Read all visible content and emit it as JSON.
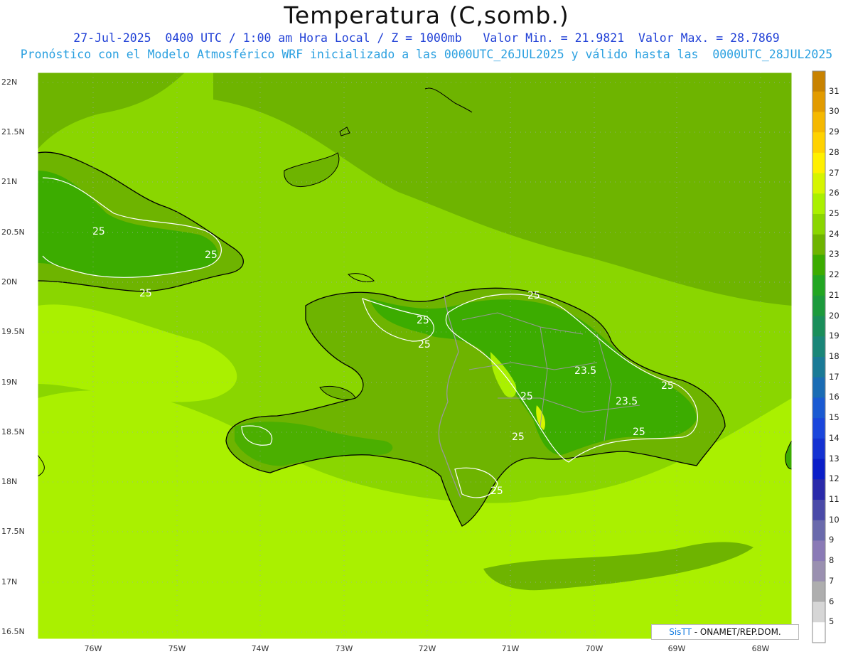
{
  "title": "Temperatura (C,somb.)",
  "subtitle_line1": "27-Jul-2025  0400 UTC / 1:00 am Hora Local / Z = 1000mb   Valor Min. = 21.9821  Valor Max. = 28.7869",
  "subtitle_line2": "Pronóstico con el Modelo Atmosférico WRF inicializado a las 0000UTC_26JUL2025 y válido hasta las  0000UTC_28JUL2025",
  "lat_labels": [
    "22N",
    "21.5N",
    "21N",
    "20.5N",
    "20N",
    "19.5N",
    "19N",
    "18.5N",
    "18N",
    "17.5N",
    "17N",
    "16.5N"
  ],
  "lon_labels": [
    "76W",
    "75W",
    "74W",
    "73W",
    "72W",
    "71W",
    "70W",
    "69W",
    "68W"
  ],
  "contour_labels": [
    "25",
    "25",
    "25",
    "25",
    "25",
    "25",
    "23.5",
    "23.5",
    "25",
    "25",
    "25",
    "25",
    "25"
  ],
  "colorbar": {
    "labels": [
      "31",
      "30",
      "29",
      "28",
      "27",
      "26",
      "25",
      "24",
      "23",
      "22",
      "21",
      "20",
      "19",
      "18",
      "17",
      "16",
      "15",
      "14",
      "13",
      "12",
      "11",
      "10",
      "9",
      "8",
      "7",
      "6",
      "5"
    ],
    "colors": [
      "#c88200",
      "#e29b00",
      "#f5b800",
      "#ffd200",
      "#fff000",
      "#d6f500",
      "#aaf000",
      "#8ad600",
      "#6eb400",
      "#3cac00",
      "#22a622",
      "#1c9a3c",
      "#1a8e5a",
      "#1a8678",
      "#1a7a96",
      "#1a6cb4",
      "#1a5ad2",
      "#1a46dc",
      "#1432d2",
      "#0a1ec8",
      "#2a2aaa",
      "#4a4aa8",
      "#6a6aac",
      "#8a7ab6",
      "#9a90b0",
      "#aeaeae",
      "#d6d6d6",
      "#ffffff"
    ]
  },
  "credit": {
    "brand": "SisTT",
    "text": " - ONAMET/REP.DOM."
  }
}
